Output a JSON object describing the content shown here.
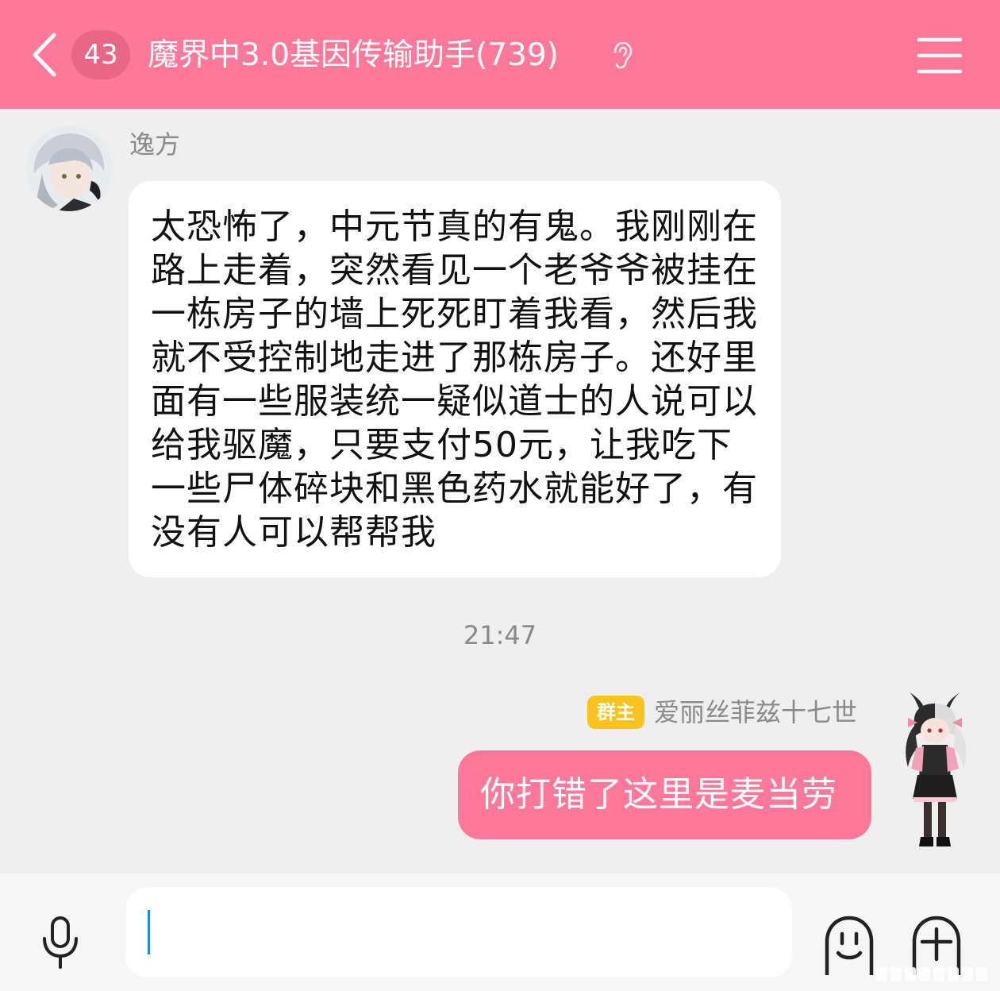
{
  "header": {
    "unread_count": "43",
    "title": "魔界中3.0基因传输助手(739)",
    "back_icon": "chevron-left-icon",
    "ear_icon": "ear-icon",
    "menu_icon": "hamburger-menu-icon"
  },
  "messages": [
    {
      "sender": "逸方",
      "text": "太恐怖了，中元节真的有鬼。我刚刚在路上走着，突然看见一个老爷爷被挂在一栋房子的墙上死死盯着我看，然后我就不受控制地走进了那栋房子。还好里面有一些服装统一疑似道士的人说可以给我驱魔，只要支付50元，让我吃下一些尸体碎块和黑色药水就能好了，有没有人可以帮帮我"
    },
    {
      "sender": "爱丽丝菲兹十七世",
      "badge": "群主",
      "text": "你打错了这里是麦当劳"
    }
  ],
  "timestamp": "21:47",
  "input": {
    "value": "",
    "mic_icon": "microphone-icon",
    "emoji_icon": "smiley-face-icon",
    "plus_icon": "plus-circle-icon"
  },
  "colors": {
    "accent": "#fd7899",
    "owner_badge": "#f9c21d",
    "background": "#efefef"
  }
}
